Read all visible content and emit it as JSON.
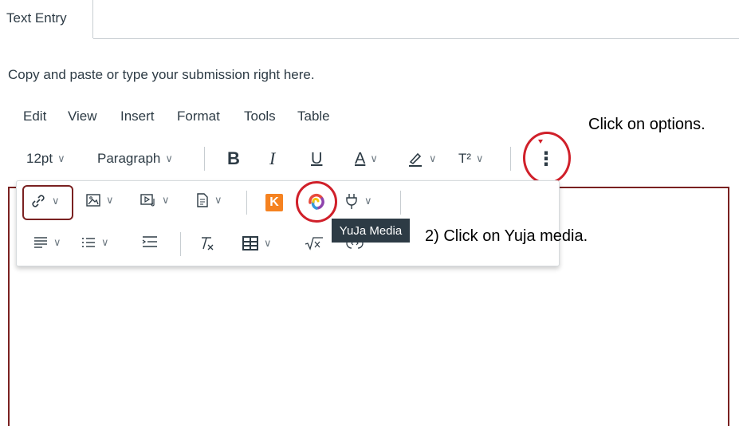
{
  "tab": {
    "label": "Text Entry"
  },
  "instruction": "Copy and paste or type your submission right here.",
  "menubar": [
    "Edit",
    "View",
    "Insert",
    "Format",
    "Tools",
    "Table"
  ],
  "toolbar": {
    "font_size": "12pt",
    "block_format": "Paragraph",
    "bold": "B",
    "italic": "I",
    "underline": "U",
    "text_color": "A",
    "superscript": "T²",
    "more": "⋮"
  },
  "popup": {
    "k_label": "K",
    "tooltip": "YuJa Media"
  },
  "annotations": {
    "options": "Click on options.",
    "yuja": "2) Click on Yuja media."
  },
  "colors": {
    "annotation_red": "#d0202a",
    "highlight_border": "#7a2121",
    "k_orange": "#f58220",
    "tooltip_bg": "#2d3b45"
  }
}
